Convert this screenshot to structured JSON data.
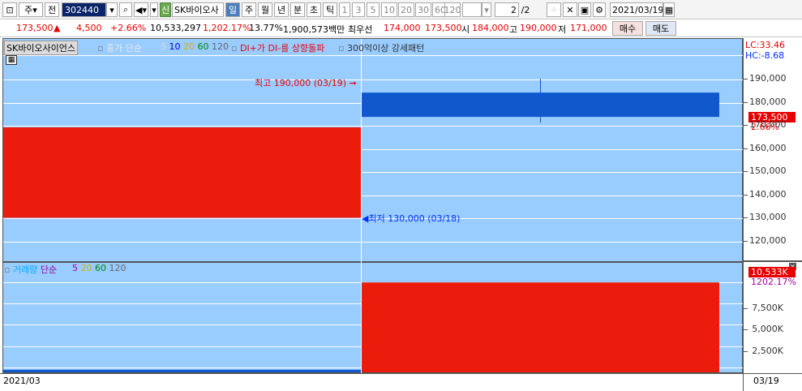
{
  "toolbar": {
    "mode": "주",
    "prev_label": "전",
    "code": "302440",
    "stock_name": "SK바이오사",
    "badge": "신",
    "periods": [
      "일",
      "주",
      "월",
      "년",
      "분",
      "초",
      "틱"
    ],
    "intervals": [
      "1",
      "3",
      "5",
      "10",
      "20",
      "30",
      "60",
      "120"
    ],
    "page": "2",
    "page_total": "/2",
    "date": "2021/03/19"
  },
  "price_row": {
    "price": "173,500",
    "arrow": "▲",
    "change": "4,500",
    "change_pct": "+2.66%",
    "volume": "10,533,297",
    "volume_pct": "1,202.17%",
    "turnover": "13.77%",
    "amount": "1,900,573백만",
    "best_label": "최우선",
    "best_ask": "174,000",
    "best_bid": "173,500",
    "open_label": "시",
    "open": "184,000",
    "high_label": "고",
    "high": "190,000",
    "low_label": "저",
    "low": "171,000",
    "buy_label": "매수",
    "sell_label": "매도"
  },
  "price_chart": {
    "name": "SK바이오사이언스",
    "indicator": "종가 단순",
    "ma": [
      "5",
      "10",
      "20",
      "60",
      "120"
    ],
    "ma_colors": [
      "#d9d9d9",
      "#0000cc",
      "#d4b000",
      "#008800",
      "#666666"
    ],
    "signal1": "DI+가 DI-를 상향돌파",
    "signal2": "300억이상 강세패턴",
    "lc": "LC:33.46",
    "hc": "HC:-8.68",
    "high_note": "최고 190,000 (03/19)",
    "low_note": "최저 130,000 (03/18)",
    "cur_price": "173,500",
    "cur_pct": "2.66%",
    "yticks": [
      "190,000",
      "180,000",
      "170,000",
      "160,000",
      "150,000",
      "140,000",
      "130,000",
      "120,000"
    ]
  },
  "volume_chart": {
    "title": "거래량",
    "indicator": "단순",
    "ma": [
      "5",
      "20",
      "60",
      "120"
    ],
    "ma_colors": [
      "#a000a0",
      "#d4b000",
      "#008800",
      "#666666"
    ],
    "cur_vol": "10,533K",
    "cur_pct": "1202.17%",
    "yticks": [
      "7,500K",
      "5,000K",
      "2,500K"
    ]
  },
  "x_axis": {
    "left_label": "2021/03",
    "right_label": "03/19"
  },
  "chart_data": {
    "type": "candlestick",
    "candles": [
      {
        "date": "2021/03/18",
        "open": 169000,
        "high": 169000,
        "low": 130000,
        "close": 130000,
        "color": "red",
        "volume": 300000
      },
      {
        "date": "2021/03/19",
        "open": 184000,
        "high": 190000,
        "low": 171000,
        "close": 173500,
        "color": "blue",
        "volume": 10533297
      }
    ],
    "ylim": [
      110000,
      200000
    ]
  },
  "colors": {
    "bg": "#99ccff",
    "up": "#ec1c0c",
    "down": "#1058cc"
  }
}
